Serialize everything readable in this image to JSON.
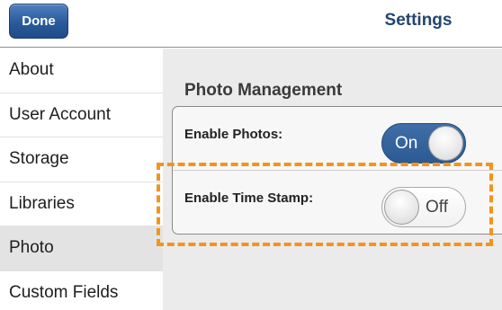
{
  "header": {
    "done_label": "Done",
    "title": "Settings"
  },
  "sidebar": {
    "items": [
      {
        "label": "About",
        "active": false
      },
      {
        "label": "User Account",
        "active": false
      },
      {
        "label": "Storage",
        "active": false
      },
      {
        "label": "Libraries",
        "active": false
      },
      {
        "label": "Photo",
        "active": true
      },
      {
        "label": "Custom Fields",
        "active": false
      }
    ]
  },
  "main": {
    "section_title": "Photo Management",
    "settings": [
      {
        "label": "Enable Photos:",
        "state": "On"
      },
      {
        "label": "Enable Time Stamp:",
        "state": "Off"
      }
    ]
  },
  "colors": {
    "accent": "#2c5a93",
    "title": "#23466f",
    "highlight": "#f2941e"
  }
}
